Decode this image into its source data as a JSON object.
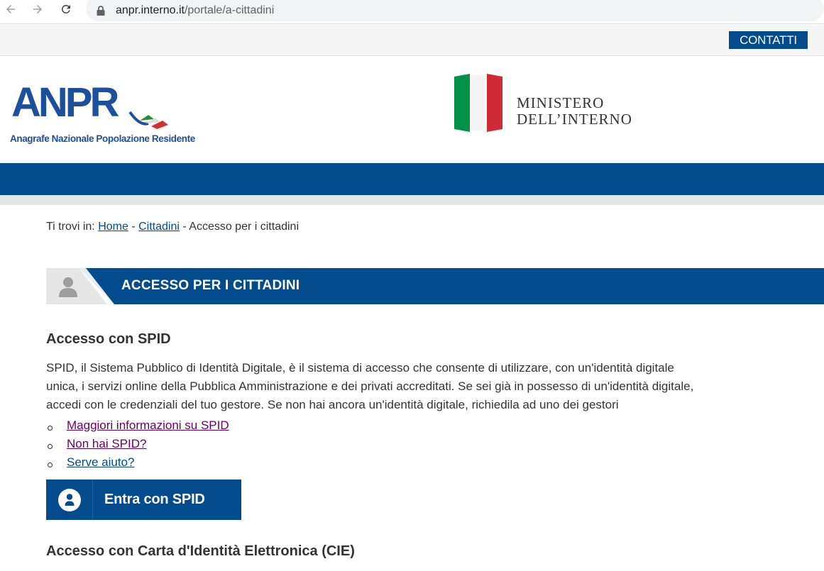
{
  "browser": {
    "url_host": "anpr.interno.it",
    "url_path": "/portale/a-cittadini"
  },
  "top_bar": {
    "contatti_label": "CONTATTI"
  },
  "header": {
    "anpr_logo_text": "ANPR",
    "anpr_tagline": "Anagrafe Nazionale Popolazione Residente",
    "ministero_line1": "MINISTERO",
    "ministero_line2": "DELL’INTERNO"
  },
  "breadcrumb": {
    "prefix": "Ti trovi in: ",
    "home": "Home",
    "sep1": " - ",
    "cittadini": "Cittadini",
    "sep2": " - ",
    "current": "Accesso per i cittadini"
  },
  "section": {
    "title": "ACCESSO PER I CITTADINI"
  },
  "spid": {
    "heading": "Accesso con SPID",
    "paragraph": "SPID, il Sistema Pubblico di Identità Digitale, è il sistema di accesso che consente di utilizzare, con un'identità digitale unica, i servizi online della Pubblica Amministrazione e dei privati accreditati. Se sei già in possesso di un'identità digitale, accedi con le credenziali del tuo gestore. Se non hai ancora un'identità digitale, richiedila ad uno dei gestori",
    "links": [
      {
        "label": "Maggiori informazioni su SPID",
        "visited": true
      },
      {
        "label": "Non hai SPID?",
        "visited": true
      },
      {
        "label": "Serve aiuto?",
        "visited": false
      }
    ],
    "button_label": "Entra con SPID"
  },
  "cie": {
    "heading": "Accesso con Carta d'Identità Elettronica (CIE)"
  },
  "colors": {
    "brand_blue": "#034b8c",
    "visited_link": "#660066",
    "text": "#333333",
    "flag_green": "#009246",
    "flag_red": "#ce2b37"
  },
  "icons": {
    "back": "arrow-left-icon",
    "forward": "arrow-right-icon",
    "reload": "reload-icon",
    "lock": "lock-icon",
    "section_person": "person-icon",
    "spid_user": "user-circle-icon"
  }
}
